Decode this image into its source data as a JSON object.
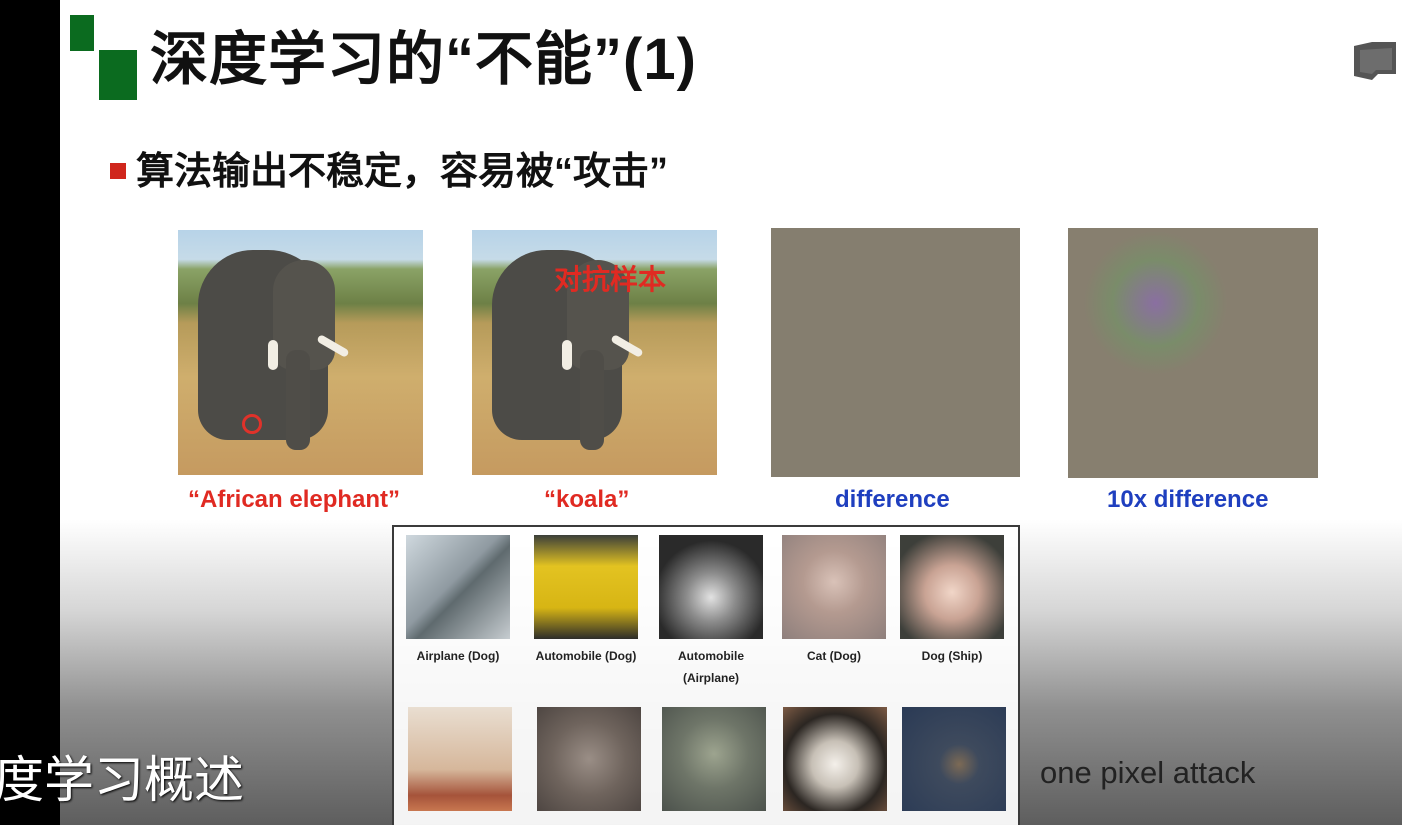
{
  "slide": {
    "title": "深度学习的“不能”(1)",
    "bullet": "算法输出不稳定，容易被“攻击”",
    "adversarial_overlay": "对抗样本",
    "attack_label": "one pixel attack"
  },
  "top_row": {
    "captions": [
      "“African elephant”",
      "“koala”",
      "difference",
      "10x difference"
    ]
  },
  "grid": {
    "row1_labels": [
      "Airplane (Dog)",
      "Automobile (Dog)",
      "Automobile (Airplane)",
      "Cat (Dog)",
      "Dog (Ship)"
    ]
  },
  "subtitle": "度学习概述",
  "colors": {
    "logo_green": "#0b6b1f",
    "bullet_red": "#d0261c",
    "caption_red": "#e02a22",
    "caption_blue": "#1f3fbf"
  },
  "icons": [
    "book-icon"
  ]
}
